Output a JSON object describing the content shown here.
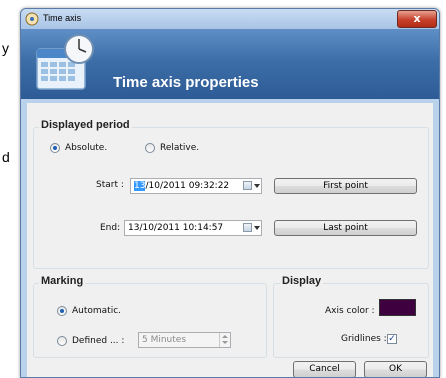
{
  "background": {
    "left_chars": [
      "y",
      "d"
    ]
  },
  "window": {
    "title": "Time axis",
    "close_label": "x",
    "banner_title": "Time axis properties"
  },
  "displayed_period": {
    "title": "Displayed period",
    "mode_options": [
      {
        "label": "Absolute.",
        "checked": true
      },
      {
        "label": "Relative.",
        "checked": false
      }
    ],
    "start": {
      "label": "Start :",
      "value_selected": "13",
      "value_rest": "/10/2011 09:32:22",
      "button": "First point"
    },
    "end": {
      "label": "End:",
      "value": "13/10/2011 10:14:57",
      "button": "Last point"
    }
  },
  "marking": {
    "title": "Marking",
    "automatic": {
      "label": "Automatic.",
      "checked": true
    },
    "defined": {
      "label": "Defined ... :",
      "checked": false,
      "value": "5 Minutes"
    }
  },
  "display": {
    "title": "Display",
    "axis_color_label": "Axis color :",
    "axis_color": "#3f0040",
    "gridlines_label": "Gridlines :",
    "gridlines_checked": true
  },
  "footer": {
    "cancel": "Cancel",
    "ok": "OK"
  }
}
